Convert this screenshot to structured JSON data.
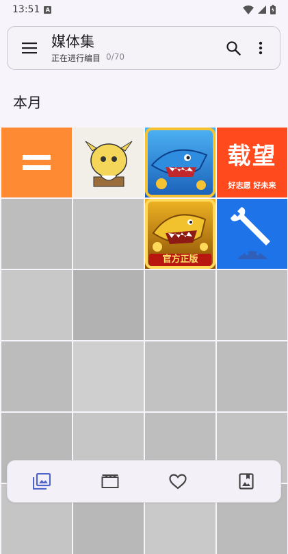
{
  "status_bar": {
    "time": "13:51",
    "a_badge": "A"
  },
  "top_bar": {
    "title": "媒体集",
    "subtitle": "正在进行编目",
    "count": "0/70",
    "icons": {
      "menu": "menu-icon",
      "search": "search-icon",
      "more": "more-vert-icon"
    }
  },
  "section": {
    "title": "本月"
  },
  "grid": {
    "cells": [
      {
        "kind": "app-icon",
        "name": "equals-app-icon",
        "bg": "#ff8a34"
      },
      {
        "kind": "app-icon",
        "name": "cartoon-go-app-icon",
        "bg": "#f2eee8"
      },
      {
        "kind": "app-icon",
        "name": "shark-game-app-icon",
        "bg": "#1e7fd6"
      },
      {
        "kind": "app-icon",
        "name": "zaiwang-app-icon",
        "bg": "#ff4a1d",
        "text_main": "载望",
        "text_sub": "好志愿 好未来"
      },
      {
        "kind": "placeholder",
        "bg": "#bdbdbd"
      },
      {
        "kind": "placeholder",
        "bg": "#c4c4c4"
      },
      {
        "kind": "app-icon",
        "name": "golden-shark-app-icon",
        "bg": "#b97a10",
        "text_main": "官方正版"
      },
      {
        "kind": "app-icon",
        "name": "dev-tools-app-icon",
        "bg": "#1e73e8"
      },
      {
        "kind": "placeholder",
        "bg": "#c8c8c8"
      },
      {
        "kind": "placeholder",
        "bg": "#b2b2b2"
      },
      {
        "kind": "placeholder",
        "bg": "#bfbfbf"
      },
      {
        "kind": "placeholder",
        "bg": "#c0c0c0"
      },
      {
        "kind": "placeholder",
        "bg": "#bcbcbc"
      },
      {
        "kind": "placeholder",
        "bg": "#cfcfcf"
      },
      {
        "kind": "placeholder",
        "bg": "#c2c2c2"
      },
      {
        "kind": "placeholder",
        "bg": "#bdbdbd"
      },
      {
        "kind": "placeholder",
        "bg": "#b9b9b9"
      },
      {
        "kind": "placeholder",
        "bg": "#c6c6c6"
      },
      {
        "kind": "placeholder",
        "bg": "#bebebe"
      },
      {
        "kind": "placeholder",
        "bg": "#c3c3c3"
      },
      {
        "kind": "placeholder",
        "bg": "#c5c5c5"
      },
      {
        "kind": "placeholder",
        "bg": "#b8b8b8"
      },
      {
        "kind": "placeholder",
        "bg": "#c9c9c9"
      },
      {
        "kind": "placeholder",
        "bg": "#bbbbbb"
      }
    ]
  },
  "bottom_nav": {
    "items": [
      {
        "name": "nav-photos",
        "icon": "photo-library-icon",
        "active": true,
        "color": "#4f63c9"
      },
      {
        "name": "nav-videos",
        "icon": "video-icon",
        "active": false,
        "color": "#444"
      },
      {
        "name": "nav-favorites",
        "icon": "heart-icon",
        "active": false,
        "color": "#444"
      },
      {
        "name": "nav-albums",
        "icon": "album-icon",
        "active": false,
        "color": "#444"
      }
    ]
  }
}
